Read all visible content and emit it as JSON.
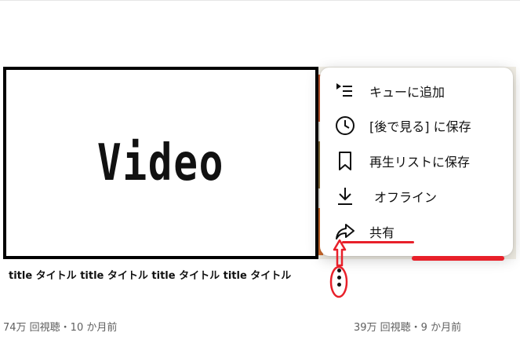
{
  "video1": {
    "thumbnail_text": "Video",
    "title": "title タイトル title タイトル title タイトル title タイトル",
    "meta": "74万 回視聴・10 か月前"
  },
  "video2": {
    "meta": "39万 回視聴・9 か月前"
  },
  "context_menu": {
    "items": [
      {
        "label": "キューに追加",
        "icon": "add-to-queue-icon"
      },
      {
        "label": "[後で見る] に保存",
        "icon": "clock-icon"
      },
      {
        "label": "再生リストに保存",
        "icon": "bookmark-icon"
      },
      {
        "label": "オフライン",
        "icon": "download-icon"
      },
      {
        "label": "共有",
        "icon": "share-icon"
      }
    ]
  },
  "more_actions_icon": "vertical-ellipsis-icon",
  "colors": {
    "annotation_red": "#e8202a",
    "meta_text": "#606060",
    "menu_background": "#ffffff"
  }
}
